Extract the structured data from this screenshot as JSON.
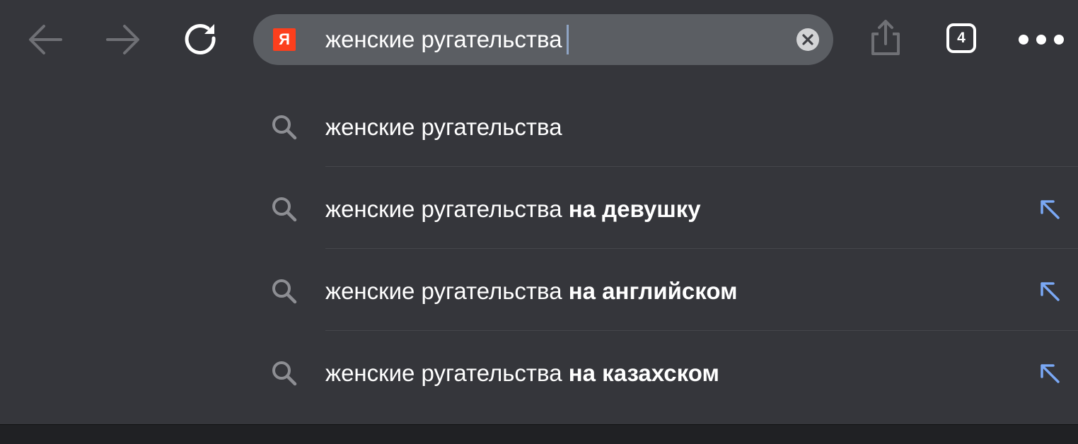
{
  "toolbar": {
    "query": "женские ругательства",
    "tab_count": "4",
    "logo_letter": "Я"
  },
  "suggestions": [
    {
      "prefix": "женские ругательства",
      "suffix": ""
    },
    {
      "prefix": "женские ругательства",
      "suffix": "на девушку"
    },
    {
      "prefix": "женские ругательства",
      "suffix": "на английском"
    },
    {
      "prefix": "женские ругательства",
      "suffix": "на казахском"
    }
  ],
  "colors": {
    "background": "#35363b",
    "omnibox": "#5b5e63",
    "logo": "#fc3f1d",
    "arrow_accent": "#7aa8f5"
  }
}
